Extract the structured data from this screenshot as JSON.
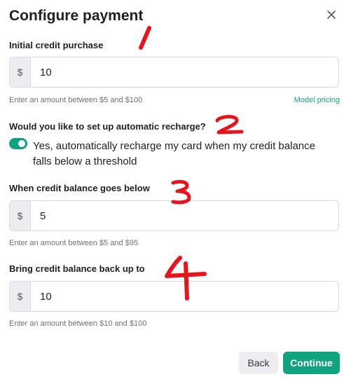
{
  "dialog": {
    "title": "Configure payment",
    "close_icon": "close-icon"
  },
  "initial_purchase": {
    "label": "Initial credit purchase",
    "prefix": "$",
    "value": "10",
    "hint": "Enter an amount between $5 and $100",
    "pricing_link": "Model pricing"
  },
  "recharge": {
    "question": "Would you like to set up automatic recharge?",
    "toggle_on": true,
    "toggle_text": "Yes, automatically recharge my card when my credit balance falls below a threshold"
  },
  "threshold": {
    "label": "When credit balance goes below",
    "prefix": "$",
    "value": "5",
    "hint": "Enter an amount between $5 and $95"
  },
  "target": {
    "label": "Bring credit balance back up to",
    "prefix": "$",
    "value": "10",
    "hint": "Enter an amount between $10 and $100"
  },
  "buttons": {
    "back": "Back",
    "continue": "Continue"
  },
  "colors": {
    "accent": "#10a37f",
    "annotation": "#e8141c"
  }
}
